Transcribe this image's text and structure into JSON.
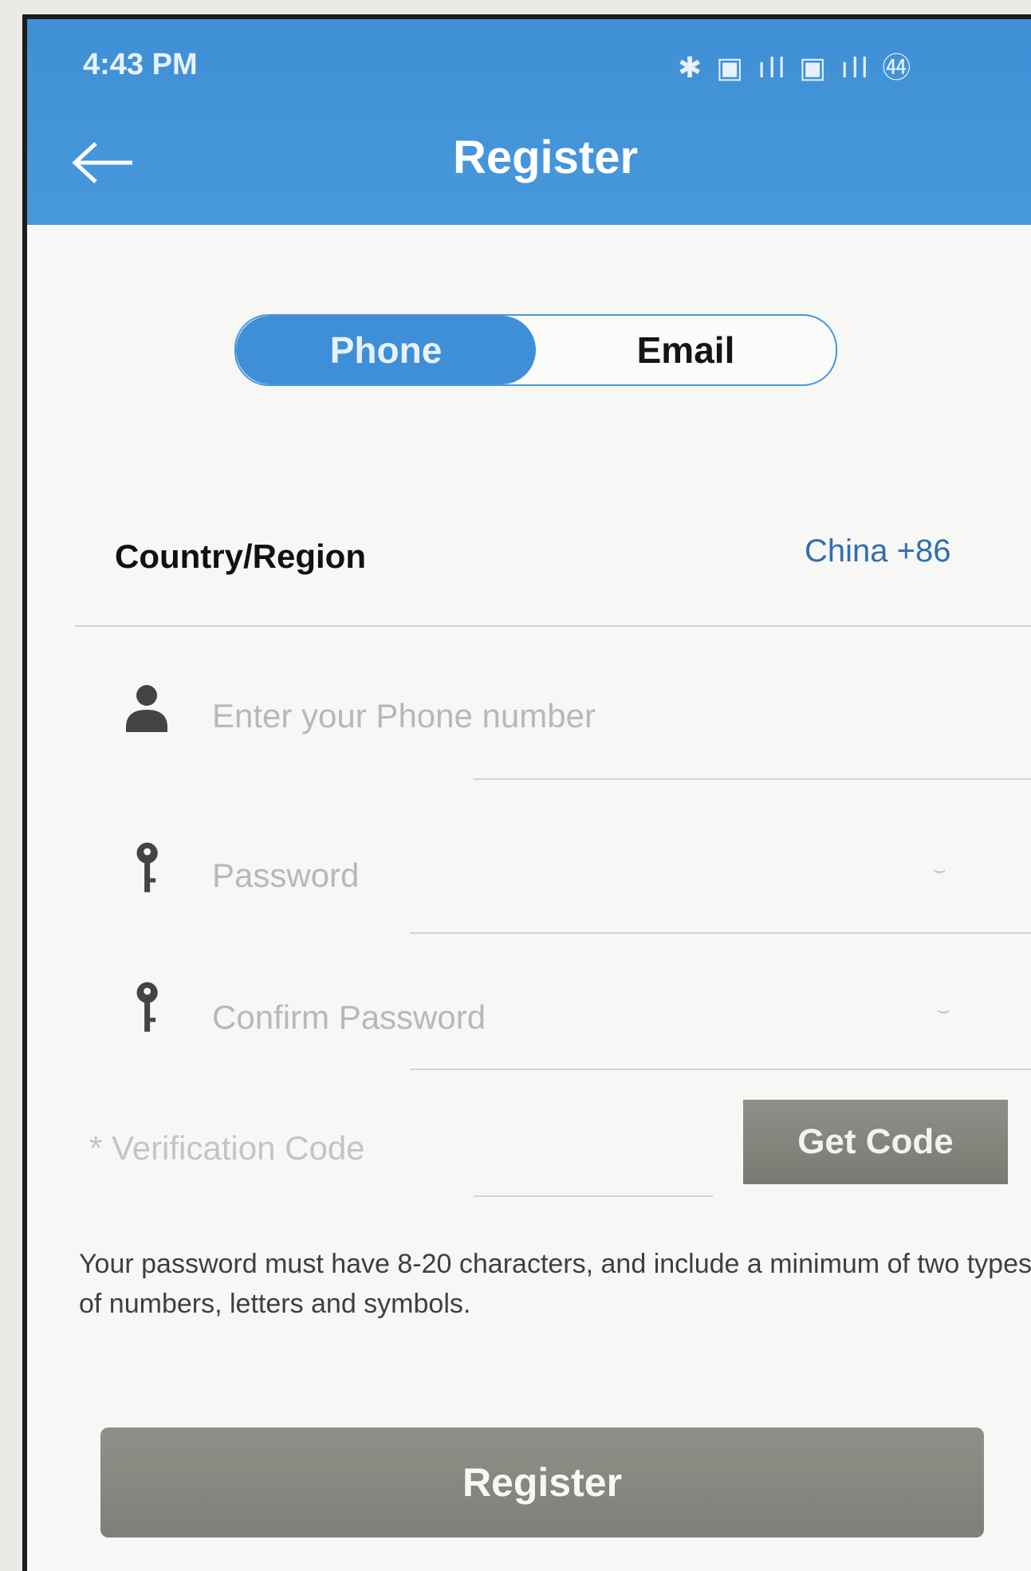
{
  "status_bar": {
    "time": "4:43 PM",
    "icons": "✱ ▣ ıll ▣ ıll ㊹"
  },
  "header": {
    "title": "Register",
    "back_icon": "arrow-left-icon"
  },
  "segment": {
    "phone_label": "Phone",
    "email_label": "Email",
    "selected": "Phone"
  },
  "form": {
    "country_label": "Country/Region",
    "country_value": "China +86",
    "phone_placeholder": "Enter your Phone number",
    "password_placeholder": "Password",
    "confirm_placeholder": "Confirm Password",
    "verification_placeholder": "* Verification Code",
    "get_code_label": "Get Code",
    "hint": "Your password must have 8-20 characters, and include a minimum of two types of numbers, letters and symbols.",
    "register_label": "Register"
  },
  "colors": {
    "header_blue": "#4898dc",
    "button_gray": "#85857e",
    "link_blue": "#2f6fb0"
  }
}
